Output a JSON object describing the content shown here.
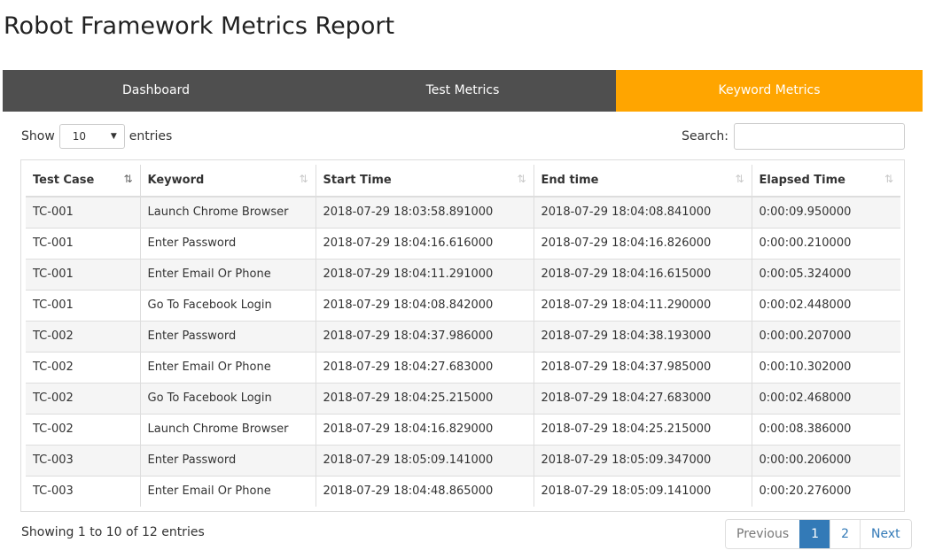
{
  "title": "Robot Framework Metrics Report",
  "nav": {
    "tabs": [
      {
        "label": "Dashboard",
        "active": false
      },
      {
        "label": "Test Metrics",
        "active": false
      },
      {
        "label": "Keyword Metrics",
        "active": true
      }
    ],
    "colors": {
      "bar": "#4f4f4f",
      "active": "#ffa500"
    }
  },
  "controls": {
    "show_label": "Show",
    "page_size": "10",
    "entries_label": "entries",
    "search_label": "Search:",
    "search_value": ""
  },
  "table": {
    "columns": [
      "Test Case",
      "Keyword",
      "Start Time",
      "End time",
      "Elapsed Time"
    ],
    "sorted_column": "Test Case",
    "rows": [
      [
        "TC-001",
        "Launch Chrome Browser",
        "2018-07-29 18:03:58.891000",
        "2018-07-29 18:04:08.841000",
        "0:00:09.950000"
      ],
      [
        "TC-001",
        "Enter Password",
        "2018-07-29 18:04:16.616000",
        "2018-07-29 18:04:16.826000",
        "0:00:00.210000"
      ],
      [
        "TC-001",
        "Enter Email Or Phone",
        "2018-07-29 18:04:11.291000",
        "2018-07-29 18:04:16.615000",
        "0:00:05.324000"
      ],
      [
        "TC-001",
        "Go To Facebook Login",
        "2018-07-29 18:04:08.842000",
        "2018-07-29 18:04:11.290000",
        "0:00:02.448000"
      ],
      [
        "TC-002",
        "Enter Password",
        "2018-07-29 18:04:37.986000",
        "2018-07-29 18:04:38.193000",
        "0:00:00.207000"
      ],
      [
        "TC-002",
        "Enter Email Or Phone",
        "2018-07-29 18:04:27.683000",
        "2018-07-29 18:04:37.985000",
        "0:00:10.302000"
      ],
      [
        "TC-002",
        "Go To Facebook Login",
        "2018-07-29 18:04:25.215000",
        "2018-07-29 18:04:27.683000",
        "0:00:02.468000"
      ],
      [
        "TC-002",
        "Launch Chrome Browser",
        "2018-07-29 18:04:16.829000",
        "2018-07-29 18:04:25.215000",
        "0:00:08.386000"
      ],
      [
        "TC-003",
        "Enter Password",
        "2018-07-29 18:05:09.141000",
        "2018-07-29 18:05:09.347000",
        "0:00:00.206000"
      ],
      [
        "TC-003",
        "Enter Email Or Phone",
        "2018-07-29 18:04:48.865000",
        "2018-07-29 18:05:09.141000",
        "0:00:20.276000"
      ]
    ]
  },
  "footer": {
    "info": "Showing 1 to 10 of 12 entries",
    "pagination": {
      "previous": "Previous",
      "pages": [
        "1",
        "2"
      ],
      "current": "1",
      "next": "Next"
    }
  }
}
